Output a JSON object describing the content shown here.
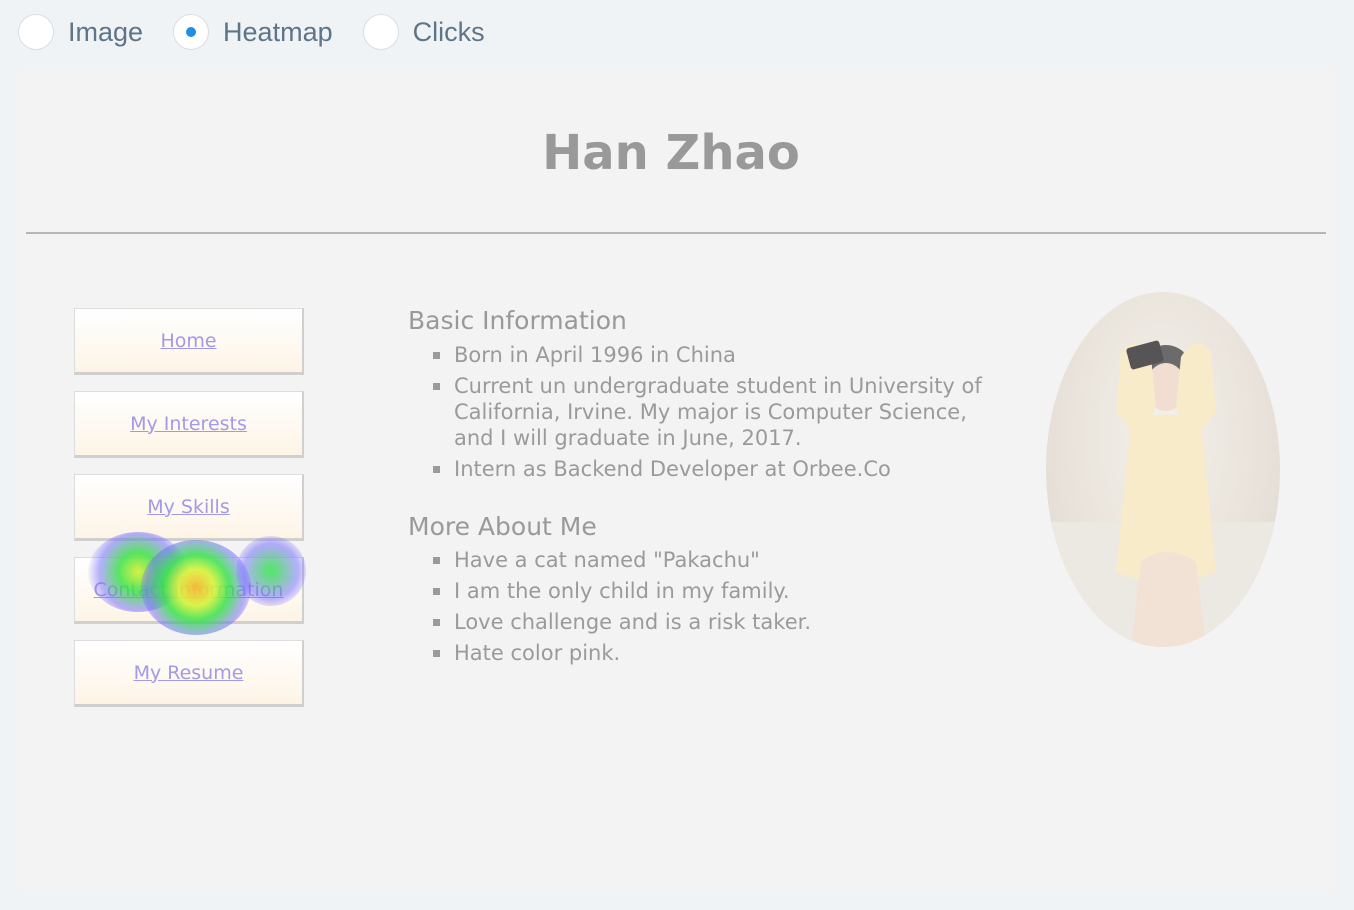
{
  "modes": [
    {
      "label": "Image",
      "selected": false
    },
    {
      "label": "Heatmap",
      "selected": true
    },
    {
      "label": "Clicks",
      "selected": false
    }
  ],
  "site": {
    "title": "Han Zhao",
    "nav": [
      "Home",
      "My Interests",
      "My Skills",
      "Contact Information",
      "My Resume"
    ],
    "basic_info": {
      "title": "Basic Information",
      "items": [
        "Born in April 1996 in China",
        "Current un undergraduate student in University of California, Irvine. My major is Computer Science, and I will graduate in June, 2017.",
        "Intern as Backend Developer at Orbee.Co"
      ]
    },
    "more_about": {
      "title": "More About Me",
      "items": [
        "Have a cat named \"Pakachu\"",
        "I am the only child in my family.",
        "Love challenge and is a risk taker.",
        "Hate color pink."
      ]
    }
  },
  "colors": {
    "accent": "#1f8fe6",
    "link": "#a39ae6",
    "heat_hot": "#f7b733",
    "heat_warm": "#d6f23a",
    "heat_mid": "#2fe04a",
    "heat_cool": "#7a7aff"
  }
}
